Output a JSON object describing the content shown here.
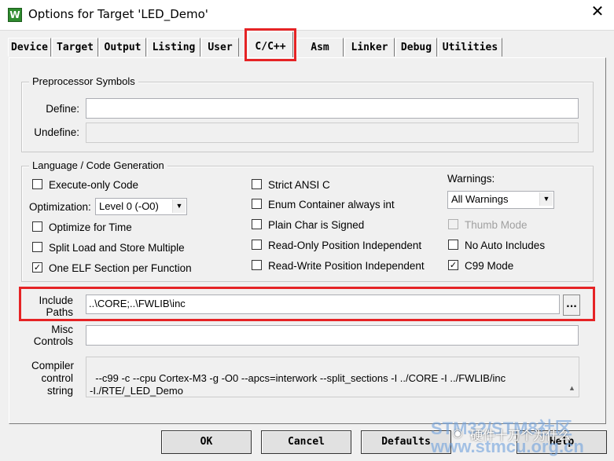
{
  "window": {
    "title": "Options for Target 'LED_Demo'",
    "app_icon": "W",
    "close_glyph": "✕"
  },
  "tabs": [
    {
      "label": "Device"
    },
    {
      "label": "Target"
    },
    {
      "label": "Output"
    },
    {
      "label": "Listing"
    },
    {
      "label": "User"
    },
    {
      "label": "C/C++"
    },
    {
      "label": "Asm"
    },
    {
      "label": "Linker"
    },
    {
      "label": "Debug"
    },
    {
      "label": "Utilities"
    }
  ],
  "preprocessor": {
    "group_title": "Preprocessor Symbols",
    "define_label": "Define:",
    "define_value": "",
    "undefine_label": "Undefine:",
    "undefine_value": ""
  },
  "language": {
    "group_title": "Language / Code Generation",
    "execute_only": {
      "label": "Execute-only Code",
      "checked": false
    },
    "optimization_label": "Optimization:",
    "optimization_value": "Level 0 (-O0)",
    "optimize_time": {
      "label": "Optimize for Time",
      "checked": false
    },
    "split_load": {
      "label": "Split Load and Store Multiple",
      "checked": false
    },
    "one_elf": {
      "label": "One ELF Section per Function",
      "checked": true,
      "mark": "✓"
    },
    "strict_ansi": {
      "label": "Strict ANSI C",
      "checked": false
    },
    "enum_container": {
      "label": "Enum Container always int",
      "checked": false
    },
    "plain_char": {
      "label": "Plain Char is Signed",
      "checked": false
    },
    "ropi": {
      "label": "Read-Only Position Independent",
      "checked": false
    },
    "rwpi": {
      "label": "Read-Write Position Independent",
      "checked": false
    },
    "warnings_label": "Warnings:",
    "warnings_value": "All Warnings",
    "thumb_mode": {
      "label": "Thumb Mode",
      "checked": false,
      "disabled": true
    },
    "no_auto_includes": {
      "label": "No Auto Includes",
      "checked": false
    },
    "c99_mode": {
      "label": "C99 Mode",
      "checked": true,
      "mark": "✓"
    }
  },
  "include": {
    "label_line1": "Include",
    "label_line2": "Paths",
    "value": "..\\CORE;..\\FWLIB\\inc",
    "browse": "..."
  },
  "misc": {
    "label_line1": "Misc",
    "label_line2": "Controls",
    "value": ""
  },
  "compiler": {
    "label_line1": "Compiler",
    "label_line2": "control",
    "label_line3": "string",
    "value": "--c99 -c --cpu Cortex-M3 -g -O0 --apcs=interwork --split_sections -I ../CORE -I ../FWLIB/inc\n-I./RTE/_LED_Demo",
    "scroll_up": "▲",
    "scroll_down": "▼"
  },
  "buttons": {
    "ok": "OK",
    "cancel": "Cancel",
    "defaults": "Defaults",
    "help": "Help"
  },
  "watermark": {
    "line1": "STM32/STM8社区",
    "line2": "硬件十万个为什么",
    "line3": "www.stmcu.org.cn"
  },
  "colors": {
    "highlight": "#e52325",
    "dialog_bg": "#f0f0f0"
  }
}
